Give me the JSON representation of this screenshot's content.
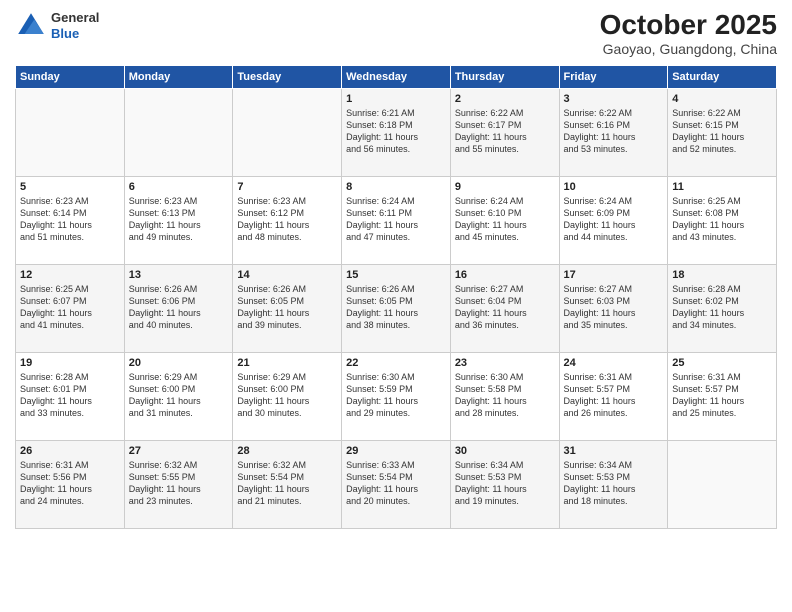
{
  "header": {
    "logo_line1": "General",
    "logo_line2": "Blue",
    "month": "October 2025",
    "location": "Gaoyao, Guangdong, China"
  },
  "days_of_week": [
    "Sunday",
    "Monday",
    "Tuesday",
    "Wednesday",
    "Thursday",
    "Friday",
    "Saturday"
  ],
  "weeks": [
    [
      {
        "num": "",
        "info": ""
      },
      {
        "num": "",
        "info": ""
      },
      {
        "num": "",
        "info": ""
      },
      {
        "num": "1",
        "info": "Sunrise: 6:21 AM\nSunset: 6:18 PM\nDaylight: 11 hours\nand 56 minutes."
      },
      {
        "num": "2",
        "info": "Sunrise: 6:22 AM\nSunset: 6:17 PM\nDaylight: 11 hours\nand 55 minutes."
      },
      {
        "num": "3",
        "info": "Sunrise: 6:22 AM\nSunset: 6:16 PM\nDaylight: 11 hours\nand 53 minutes."
      },
      {
        "num": "4",
        "info": "Sunrise: 6:22 AM\nSunset: 6:15 PM\nDaylight: 11 hours\nand 52 minutes."
      }
    ],
    [
      {
        "num": "5",
        "info": "Sunrise: 6:23 AM\nSunset: 6:14 PM\nDaylight: 11 hours\nand 51 minutes."
      },
      {
        "num": "6",
        "info": "Sunrise: 6:23 AM\nSunset: 6:13 PM\nDaylight: 11 hours\nand 49 minutes."
      },
      {
        "num": "7",
        "info": "Sunrise: 6:23 AM\nSunset: 6:12 PM\nDaylight: 11 hours\nand 48 minutes."
      },
      {
        "num": "8",
        "info": "Sunrise: 6:24 AM\nSunset: 6:11 PM\nDaylight: 11 hours\nand 47 minutes."
      },
      {
        "num": "9",
        "info": "Sunrise: 6:24 AM\nSunset: 6:10 PM\nDaylight: 11 hours\nand 45 minutes."
      },
      {
        "num": "10",
        "info": "Sunrise: 6:24 AM\nSunset: 6:09 PM\nDaylight: 11 hours\nand 44 minutes."
      },
      {
        "num": "11",
        "info": "Sunrise: 6:25 AM\nSunset: 6:08 PM\nDaylight: 11 hours\nand 43 minutes."
      }
    ],
    [
      {
        "num": "12",
        "info": "Sunrise: 6:25 AM\nSunset: 6:07 PM\nDaylight: 11 hours\nand 41 minutes."
      },
      {
        "num": "13",
        "info": "Sunrise: 6:26 AM\nSunset: 6:06 PM\nDaylight: 11 hours\nand 40 minutes."
      },
      {
        "num": "14",
        "info": "Sunrise: 6:26 AM\nSunset: 6:05 PM\nDaylight: 11 hours\nand 39 minutes."
      },
      {
        "num": "15",
        "info": "Sunrise: 6:26 AM\nSunset: 6:05 PM\nDaylight: 11 hours\nand 38 minutes."
      },
      {
        "num": "16",
        "info": "Sunrise: 6:27 AM\nSunset: 6:04 PM\nDaylight: 11 hours\nand 36 minutes."
      },
      {
        "num": "17",
        "info": "Sunrise: 6:27 AM\nSunset: 6:03 PM\nDaylight: 11 hours\nand 35 minutes."
      },
      {
        "num": "18",
        "info": "Sunrise: 6:28 AM\nSunset: 6:02 PM\nDaylight: 11 hours\nand 34 minutes."
      }
    ],
    [
      {
        "num": "19",
        "info": "Sunrise: 6:28 AM\nSunset: 6:01 PM\nDaylight: 11 hours\nand 33 minutes."
      },
      {
        "num": "20",
        "info": "Sunrise: 6:29 AM\nSunset: 6:00 PM\nDaylight: 11 hours\nand 31 minutes."
      },
      {
        "num": "21",
        "info": "Sunrise: 6:29 AM\nSunset: 6:00 PM\nDaylight: 11 hours\nand 30 minutes."
      },
      {
        "num": "22",
        "info": "Sunrise: 6:30 AM\nSunset: 5:59 PM\nDaylight: 11 hours\nand 29 minutes."
      },
      {
        "num": "23",
        "info": "Sunrise: 6:30 AM\nSunset: 5:58 PM\nDaylight: 11 hours\nand 28 minutes."
      },
      {
        "num": "24",
        "info": "Sunrise: 6:31 AM\nSunset: 5:57 PM\nDaylight: 11 hours\nand 26 minutes."
      },
      {
        "num": "25",
        "info": "Sunrise: 6:31 AM\nSunset: 5:57 PM\nDaylight: 11 hours\nand 25 minutes."
      }
    ],
    [
      {
        "num": "26",
        "info": "Sunrise: 6:31 AM\nSunset: 5:56 PM\nDaylight: 11 hours\nand 24 minutes."
      },
      {
        "num": "27",
        "info": "Sunrise: 6:32 AM\nSunset: 5:55 PM\nDaylight: 11 hours\nand 23 minutes."
      },
      {
        "num": "28",
        "info": "Sunrise: 6:32 AM\nSunset: 5:54 PM\nDaylight: 11 hours\nand 21 minutes."
      },
      {
        "num": "29",
        "info": "Sunrise: 6:33 AM\nSunset: 5:54 PM\nDaylight: 11 hours\nand 20 minutes."
      },
      {
        "num": "30",
        "info": "Sunrise: 6:34 AM\nSunset: 5:53 PM\nDaylight: 11 hours\nand 19 minutes."
      },
      {
        "num": "31",
        "info": "Sunrise: 6:34 AM\nSunset: 5:53 PM\nDaylight: 11 hours\nand 18 minutes."
      },
      {
        "num": "",
        "info": ""
      }
    ]
  ]
}
